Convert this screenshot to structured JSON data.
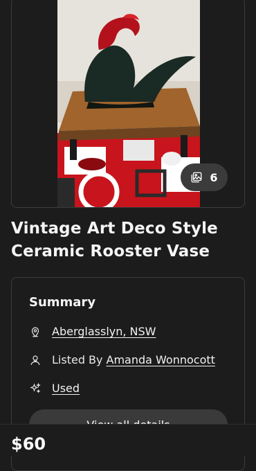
{
  "listing": {
    "photo_count": "6",
    "title": "Vintage Art Deco Style Ceramic Rooster Vase",
    "price": "$60"
  },
  "summary": {
    "heading": "Summary",
    "location": "Aberglasslyn, NSW",
    "listed_by_prefix": "Listed By",
    "seller": "Amanda Wonnocott",
    "condition": "Used",
    "view_all_label": "View all details"
  },
  "icons": {
    "location": "map-pin-icon",
    "seller": "person-icon",
    "condition": "sparkle-icon",
    "photos": "images-icon"
  },
  "colors": {
    "background": "#1c1c1c",
    "surface_border": "#3d3d3d",
    "pill": "#3a3a3a"
  }
}
